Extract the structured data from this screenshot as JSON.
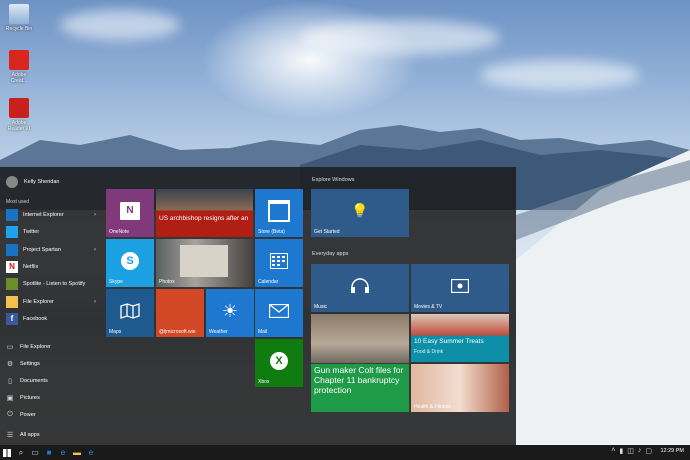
{
  "desktop": {
    "icons": [
      {
        "label": "Recycle Bin"
      },
      {
        "label": "Adobe Creat..."
      },
      {
        "label": "Adobe Reader XI"
      }
    ]
  },
  "start": {
    "user_name": "Kelly Sheridan",
    "most_used_label": "Most used",
    "apps": [
      {
        "label": "Internet Explorer",
        "color": "#1a73c2"
      },
      {
        "label": "Twitter",
        "color": "#1da1f2"
      },
      {
        "label": "Project Spartan",
        "color": "#1a73c2"
      },
      {
        "label": "Netflix",
        "color": "#ffffff"
      },
      {
        "label": "Spotlite - Listen to Spotify",
        "color": "#6a8f2a"
      },
      {
        "label": "File Explorer",
        "color": "#f2c14e"
      },
      {
        "label": "Facebook",
        "color": "#3b5998"
      }
    ],
    "system": [
      {
        "label": "File Explorer"
      },
      {
        "label": "Settings"
      },
      {
        "label": "Documents"
      },
      {
        "label": "Pictures"
      },
      {
        "label": "Power"
      },
      {
        "label": "All apps"
      }
    ],
    "tiles": {
      "onenote": "OneNote",
      "news_headline": "US archbishop resigns after an",
      "store": "Store (Beta)",
      "skype": "Skype",
      "photos": "Photos",
      "calendar": "Calendar",
      "maps": "Maps",
      "office_tile": "@ijmicrosoft.wie",
      "weather": "Weather",
      "mail": "Mail",
      "xbox": "Xbox"
    },
    "explore_header": "Explore Windows",
    "get_started": "Get Started",
    "everyday_header": "Everyday apps",
    "music": "Music",
    "movies": "Movies & TV",
    "food_title": "10 Easy Summer Treats",
    "food_sub": "Food & Drink",
    "health_label": "Health & Fitness",
    "news_big": "Gun maker Colt files for Chapter 11 bankruptcy protection"
  },
  "taskbar": {
    "clock": "12:29 PM"
  }
}
